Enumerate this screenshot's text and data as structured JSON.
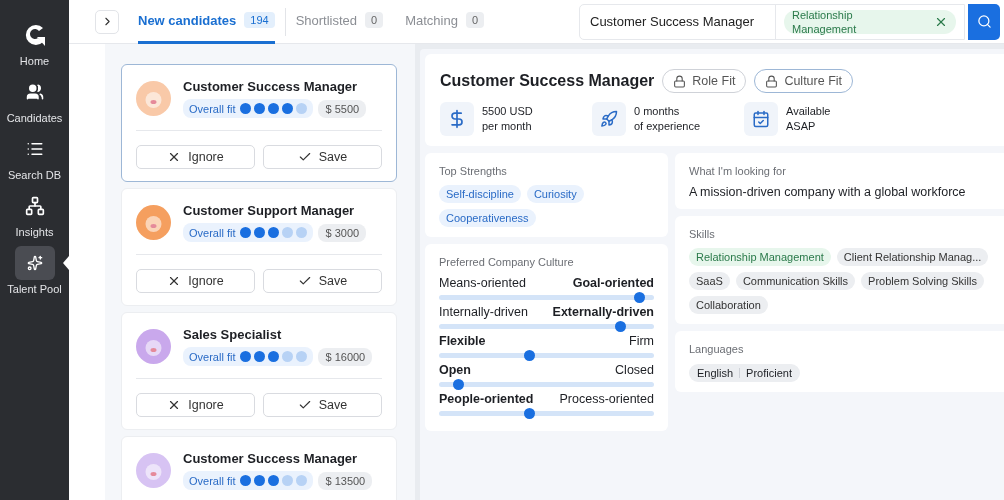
{
  "sidebar": {
    "items": [
      {
        "label": "Home",
        "kind": "logo",
        "selected": false
      },
      {
        "label": "Candidates",
        "kind": "people",
        "selected": false
      },
      {
        "label": "Search DB",
        "kind": "list",
        "selected": false
      },
      {
        "label": "Insights",
        "kind": "network",
        "selected": false
      },
      {
        "label": "Talent Pool",
        "kind": "sparkle",
        "selected": true
      }
    ]
  },
  "tabs": [
    {
      "label": "New candidates",
      "count": "194",
      "selected": true
    },
    {
      "label": "Shortlisted",
      "count": "0",
      "selected": false
    },
    {
      "label": "Matching",
      "count": "0",
      "selected": false
    }
  ],
  "search": {
    "value": "Customer Success Manager",
    "tags": [
      "Relationship Management"
    ]
  },
  "candidates": [
    {
      "title": "Customer Success Manager",
      "fit_label": "Overall fit",
      "stars": 4,
      "salary": "$ 5500",
      "color": "#f9c9a8",
      "selected": true,
      "buttons": [
        "Ignore",
        "Save"
      ]
    },
    {
      "title": "Customer Support Manager",
      "fit_label": "Overall fit",
      "stars": 3,
      "salary": "$ 3000",
      "color": "#f59f5f",
      "selected": false,
      "buttons": [
        "Ignore",
        "Save"
      ]
    },
    {
      "title": "Sales Specialist",
      "fit_label": "Overall fit",
      "stars": 3,
      "salary": "$ 16000",
      "color": "#c9a8ec",
      "selected": false,
      "buttons": [
        "Ignore",
        "Save"
      ]
    },
    {
      "title": "Customer Success Manager",
      "fit_label": "Overall fit",
      "stars": 3,
      "salary": "$ 13500",
      "color": "#d7c3f3",
      "selected": false
    }
  ],
  "detail": {
    "title": "Customer Success Manager",
    "fit_buttons": [
      "Role Fit",
      "Culture Fit"
    ],
    "facts": [
      {
        "kind": "dollar",
        "lines": [
          "5500 USD",
          "per month"
        ]
      },
      {
        "kind": "rocket",
        "lines": [
          "0 months",
          "of experience"
        ]
      },
      {
        "kind": "calendar",
        "lines": [
          "Available",
          "ASAP"
        ]
      }
    ],
    "strengths": {
      "title": "Top Strengths",
      "tags": [
        "Self-discipline",
        "Curiosity",
        "Cooperativeness"
      ]
    },
    "culture": {
      "title": "Preferred Company Culture",
      "scales": [
        {
          "left": "Means-oriented",
          "right": "Goal-oriented",
          "left_bold": false,
          "level": 0.93
        },
        {
          "left": "Internally-driven",
          "right": "Externally-driven",
          "left_bold": false,
          "level": 0.84
        },
        {
          "left": "Flexible",
          "right": "Firm",
          "left_bold": true,
          "level": 0.42
        },
        {
          "left": "Open",
          "right": "Closed",
          "left_bold": true,
          "level": 0.09
        },
        {
          "left": "People-oriented",
          "right": "Process-oriented",
          "left_bold": true,
          "level": 0.42
        }
      ]
    },
    "looking_for": {
      "title": "What I'm looking for",
      "text": "A mission-driven company with a global workforce"
    },
    "skills": {
      "title": "Skills",
      "tags": [
        {
          "label": "Relationship Management",
          "matched": true
        },
        {
          "label": "Client Relationship Manag...",
          "matched": false
        },
        {
          "label": "SaaS",
          "matched": false
        },
        {
          "label": "Communication Skills",
          "matched": false
        },
        {
          "label": "Problem Solving Skills",
          "matched": false
        },
        {
          "label": "Collaboration",
          "matched": false
        }
      ]
    },
    "languages": {
      "title": "Languages",
      "items": [
        {
          "language": "English",
          "level": "Proficient"
        }
      ]
    }
  }
}
